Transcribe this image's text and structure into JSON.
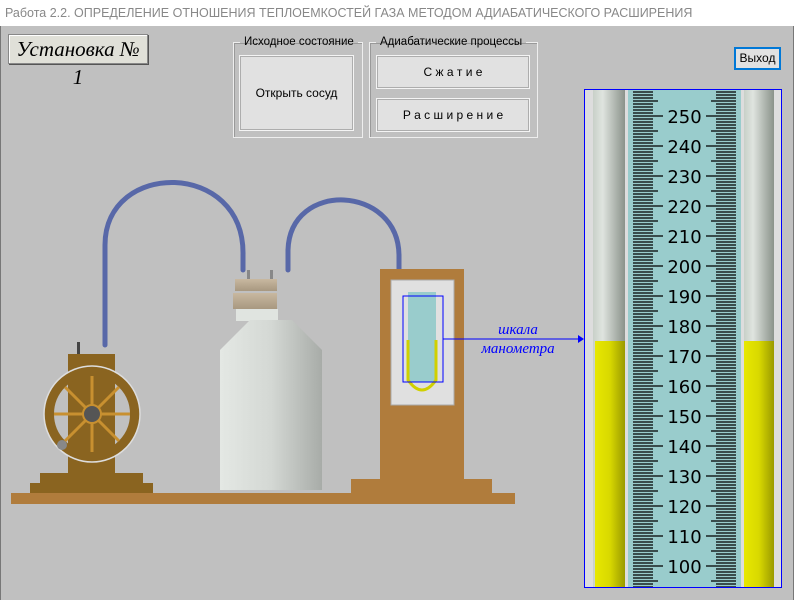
{
  "window": {
    "title": "Работа 2.2. ОПРЕДЕЛЕНИЕ ОТНОШЕНИЯ ТЕПЛОЕМКОСТЕЙ ГАЗА МЕТОДОМ АДИАБАТИЧЕСКОГО РАСШИРЕНИЯ"
  },
  "setup_label": "Установка № 1",
  "initial_state": {
    "legend": "Исходное состояние",
    "open_button": "Открыть сосуд"
  },
  "adiabatic": {
    "legend": "Адиабатические процессы",
    "compress_button": "С ж а т и е",
    "expand_button": "Р а с ш и р е н и е"
  },
  "exit_button": "Выход",
  "manometer_label": {
    "line1": "шкала",
    "line2": "манометра"
  },
  "manometer": {
    "tick_labels": [
      "250",
      "240",
      "230",
      "220",
      "210",
      "200",
      "190",
      "180",
      "170",
      "160",
      "150",
      "140",
      "130",
      "120",
      "110",
      "100"
    ],
    "liquid_level": 175,
    "liquid_color": "#d8d800",
    "scale_color": "#99cccc"
  },
  "colors": {
    "tube": "#5868a8",
    "wood": "#b07c3c",
    "pump": "#8a6420"
  }
}
